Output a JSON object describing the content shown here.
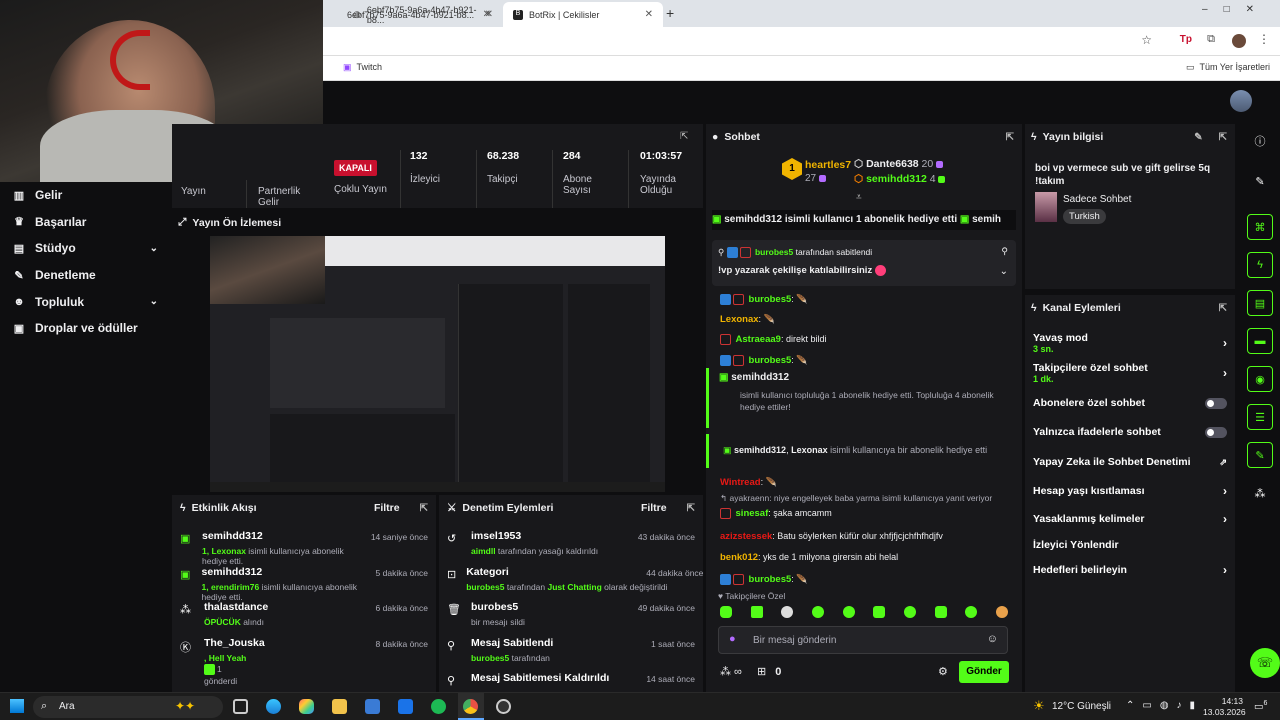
{
  "browser": {
    "tabs": [
      {
        "label": "6ebf7b75-9a6a-4b47-b921-b8..."
      },
      {
        "label": "BotRix | Cekilisler"
      }
    ],
    "bookmarks": {
      "twitch": "Twitch",
      "all_bookmarks": "Tüm Yer İşaretleri"
    }
  },
  "sidebar": {
    "items": [
      {
        "label": "Gelir",
        "icon": "bar-chart-icon"
      },
      {
        "label": "Başarılar",
        "icon": "trophy-icon"
      },
      {
        "label": "Stüdyo",
        "icon": "film-icon",
        "chevron": true
      },
      {
        "label": "Denetleme",
        "icon": "wrench-icon"
      },
      {
        "label": "Topluluk",
        "icon": "people-icon",
        "chevron": true
      },
      {
        "label": "Droplar ve ödüller",
        "icon": "gift-icon"
      }
    ]
  },
  "stats": {
    "yayin": "Yayın",
    "partnerlik": "Partnerlik Gelir",
    "status_badge": "KAPALI",
    "coklu_yayin": "Çoklu Yayın",
    "viewers_value": "132",
    "viewers_label": "İzleyici",
    "followers_value": "68.238",
    "followers_label": "Takipçi",
    "subs_value": "284",
    "subs_label": "Abone Sayısı",
    "uptime_value": "01:03:57",
    "uptime_label": "Yayında Olduğu"
  },
  "preview": {
    "title": "Yayın Ön İzlemesi"
  },
  "activity": {
    "title": "Etkinlik Akışı",
    "filter": "Filtre",
    "rows": [
      {
        "user": "semihdd312",
        "time": "14 saniye önce",
        "hl": "1, Lexonax",
        "text": " isimli kullanıcıya abonelik hediye etti."
      },
      {
        "user": "semihdd312",
        "time": "5 dakika önce",
        "hl": "1, erendirim76",
        "text": " isimli kullanıcıya abonelik hediye etti."
      },
      {
        "user": "thalastdance",
        "time": "6 dakika önce",
        "hl": "ÖPÜCÜK",
        "text": " alındı"
      },
      {
        "user": "The_Jouska",
        "time": "8 dakika önce",
        "hl": ", Hell Yeah",
        "text": "1",
        "extra": "gönderdi"
      }
    ]
  },
  "moderation": {
    "title": "Denetim Eylemleri",
    "filter": "Filtre",
    "rows": [
      {
        "title": "imsel1953",
        "time": "43 dakika önce",
        "hl": "aimdll",
        "text": " tarafından yasağı kaldırıldı"
      },
      {
        "title": "Kategori",
        "time": "44 dakika önce",
        "hl": "burobes5",
        "text": " tarafından ",
        "hl2": "Just Chatting",
        "text2": " olarak değiştirildi"
      },
      {
        "title": "burobes5",
        "time": "49 dakika önce",
        "text": "bir mesajı sildi"
      },
      {
        "title": "Mesaj Sabitlendi",
        "time": "1 saat önce",
        "hl": "burobes5",
        "text": " tarafından"
      },
      {
        "title": "Mesaj Sabitlemesi Kaldırıldı",
        "time": "14 saat önce"
      }
    ]
  },
  "chat": {
    "title": "Sohbet",
    "leaders": [
      {
        "rank": "1",
        "name": "heartles7",
        "count": "27"
      },
      {
        "name": "Dante6638",
        "count": "20"
      },
      {
        "name": "semihdd312",
        "count": "4"
      }
    ],
    "ticker": "semihdd312 isimli kullanıcı 1 abonelik hediye etti",
    "ticker2": "semih",
    "pinned_by": "burobes5",
    "pinned_by_suffix": " tarafından sabitlendi",
    "pinned_text": "!vp yazarak çekilişe katılabilirsiniz",
    "messages": [
      {
        "user": "burobes5",
        "text": ":",
        "color": "#53fc18"
      },
      {
        "user": "Lexonax",
        "text": ":",
        "color": "#f0b400"
      },
      {
        "user": "Astraeaa9",
        "text": ": direkt bildi",
        "color": "#53fc18"
      },
      {
        "user": "burobes5",
        "text": ":",
        "color": "#53fc18"
      }
    ],
    "gift_title": "semihdd312",
    "gift_text": "isimli kullanıcı topluluğa 1 abonelik hediye etti. Topluluğa 4 abonelik hediye ettiler!",
    "gift2_user": "semihdd312",
    "gift2_user2": "Lexonax",
    "gift2_text": " isimli kullanıcıya bir abonelik hediye etti",
    "messages2": [
      {
        "user": "Wintread",
        "text": ":",
        "color": "#e91916"
      },
      {
        "reply": "ayakraenn: niye engelleyek baba yarma isimli kullanıcıya yanıt veriyor"
      },
      {
        "user": "sinesaf",
        "text": ": şaka amcamm",
        "color": "#53fc18"
      },
      {
        "user": "azizstessek",
        "text": ": Batu söylerken küfür olur xhfjfjcjchfhfhdjfv",
        "color": "#e91916"
      },
      {
        "user": "benk012",
        "text": ": yks de 1 milyona girersin abi helal",
        "color": "#f0b400"
      },
      {
        "user": "burobes5",
        "text": ":",
        "color": "#53fc18"
      }
    ],
    "followers_only": "Takipçilere Özel",
    "input_placeholder": "Bir mesaj gönderin",
    "points": "0",
    "send": "Gönder"
  },
  "stream_info": {
    "title": "Yayın bilgisi",
    "stream_title": "boi vp vermece sub ve gift gelirse 5q !takım",
    "category": "Sadece Sohbet",
    "tag": "Turkish"
  },
  "channel_actions": {
    "title": "Kanal Eylemleri",
    "rows": [
      {
        "label": "Yavaş mod",
        "sub": "3 sn.",
        "kind": "arrow"
      },
      {
        "label": "Takipçilere özel sohbet",
        "sub": "1 dk.",
        "kind": "arrow"
      },
      {
        "label": "Abonelere özel sohbet",
        "kind": "toggle"
      },
      {
        "label": "Yalnızca ifadelerle sohbet",
        "kind": "toggle"
      },
      {
        "label": "Yapay Zeka ile Sohbet Denetimi",
        "kind": "external"
      },
      {
        "label": "Hesap yaşı kısıtlaması",
        "kind": "arrow"
      },
      {
        "label": "Yasaklanmış kelimeler",
        "kind": "arrow"
      },
      {
        "label": "İzleyici Yönlendir",
        "kind": "none"
      },
      {
        "label": "Hedefleri belirleyin",
        "kind": "arrow"
      }
    ]
  },
  "taskbar": {
    "search": "Ara",
    "weather": "12°C  Güneşli",
    "time": "14:13",
    "date": "13.03.2026",
    "notif": "6"
  }
}
